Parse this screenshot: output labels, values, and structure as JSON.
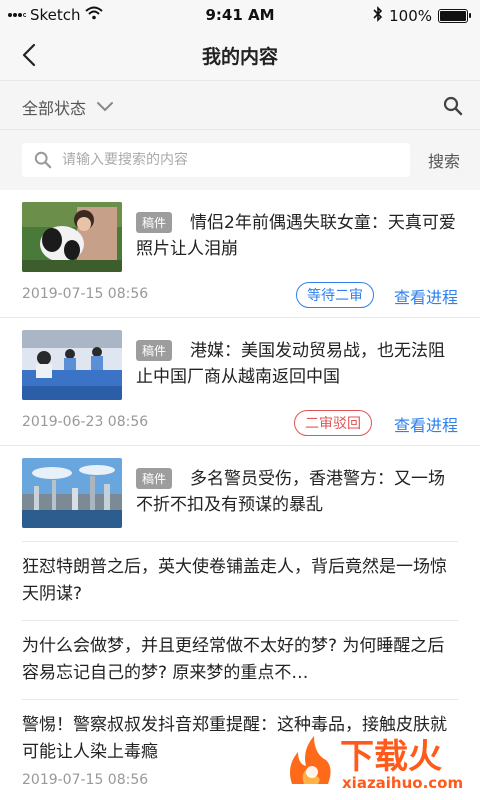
{
  "status_bar": {
    "carrier": "Sketch",
    "time": "9:41 AM",
    "battery": "100%"
  },
  "nav": {
    "title": "我的内容"
  },
  "filter": {
    "selected": "全部状态"
  },
  "search": {
    "placeholder": "请输入要搜索的内容",
    "submit_label": "搜索"
  },
  "items": [
    {
      "tag": "稿件",
      "title": "情侣2年前偶遇失联女童：天真可爱 照片让人泪崩",
      "date": "2019-07-15 08:56",
      "status": "等待二审",
      "action": "查看进程"
    },
    {
      "tag": "稿件",
      "title": "港媒：美国发动贸易战，也无法阻止中国厂商从越南返回中国",
      "date": "2019-06-23 08:56",
      "status": "二审驳回",
      "action": "查看进程"
    },
    {
      "tag": "稿件",
      "title": "多名警员受伤，香港警方：又一场不折不扣及有预谋的暴乱"
    }
  ],
  "text_items": [
    "狂怼特朗普之后，英大使卷铺盖走人，背后竟然是一场惊天阴谋?",
    "为什么会做梦，并且更经常做不太好的梦? 为何睡醒之后容易忘记自己的梦? 原来梦的重点不…",
    "警惕！警察叔叔发抖音郑重提醒：这种毒品，接触皮肤就可能让人染上毒瘾"
  ],
  "last_date": "2019-07-15 08:56",
  "watermark": {
    "brand": "下载火",
    "url": "xiazaihuo.com"
  }
}
